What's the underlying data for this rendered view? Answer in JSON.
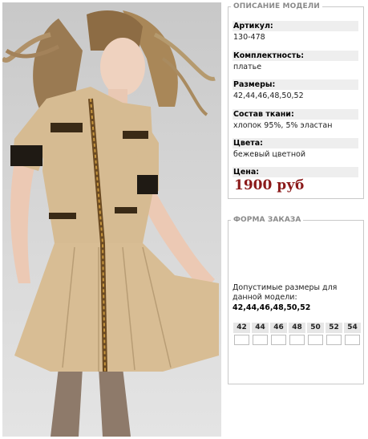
{
  "description": {
    "legend": "ОПИСАНИЕ МОДЕЛИ",
    "fields": [
      {
        "label": "Артикул:",
        "value": "130-478"
      },
      {
        "label": "Комплектность:",
        "value": "платье"
      },
      {
        "label": "Размеры:",
        "value": "42,44,46,48,50,52"
      },
      {
        "label": "Состав ткани:",
        "value": "хлопок 95%, 5% эластан"
      },
      {
        "label": "Цвета:",
        "value": "бежевый цветной"
      }
    ],
    "price_label": "Цена:",
    "price": "1900 руб"
  },
  "order": {
    "legend": "ФОРМА ЗАКАЗА",
    "sizes_text": "Допустимые размеры для данной модели:",
    "sizes_list": "42,44,46,48,50,52",
    "size_columns": [
      "42",
      "44",
      "46",
      "48",
      "50",
      "52",
      "54"
    ]
  },
  "colors": {
    "price": "#8b1a1a",
    "label_bg": "#eeeeee",
    "legend_text": "#8a8a8a"
  }
}
